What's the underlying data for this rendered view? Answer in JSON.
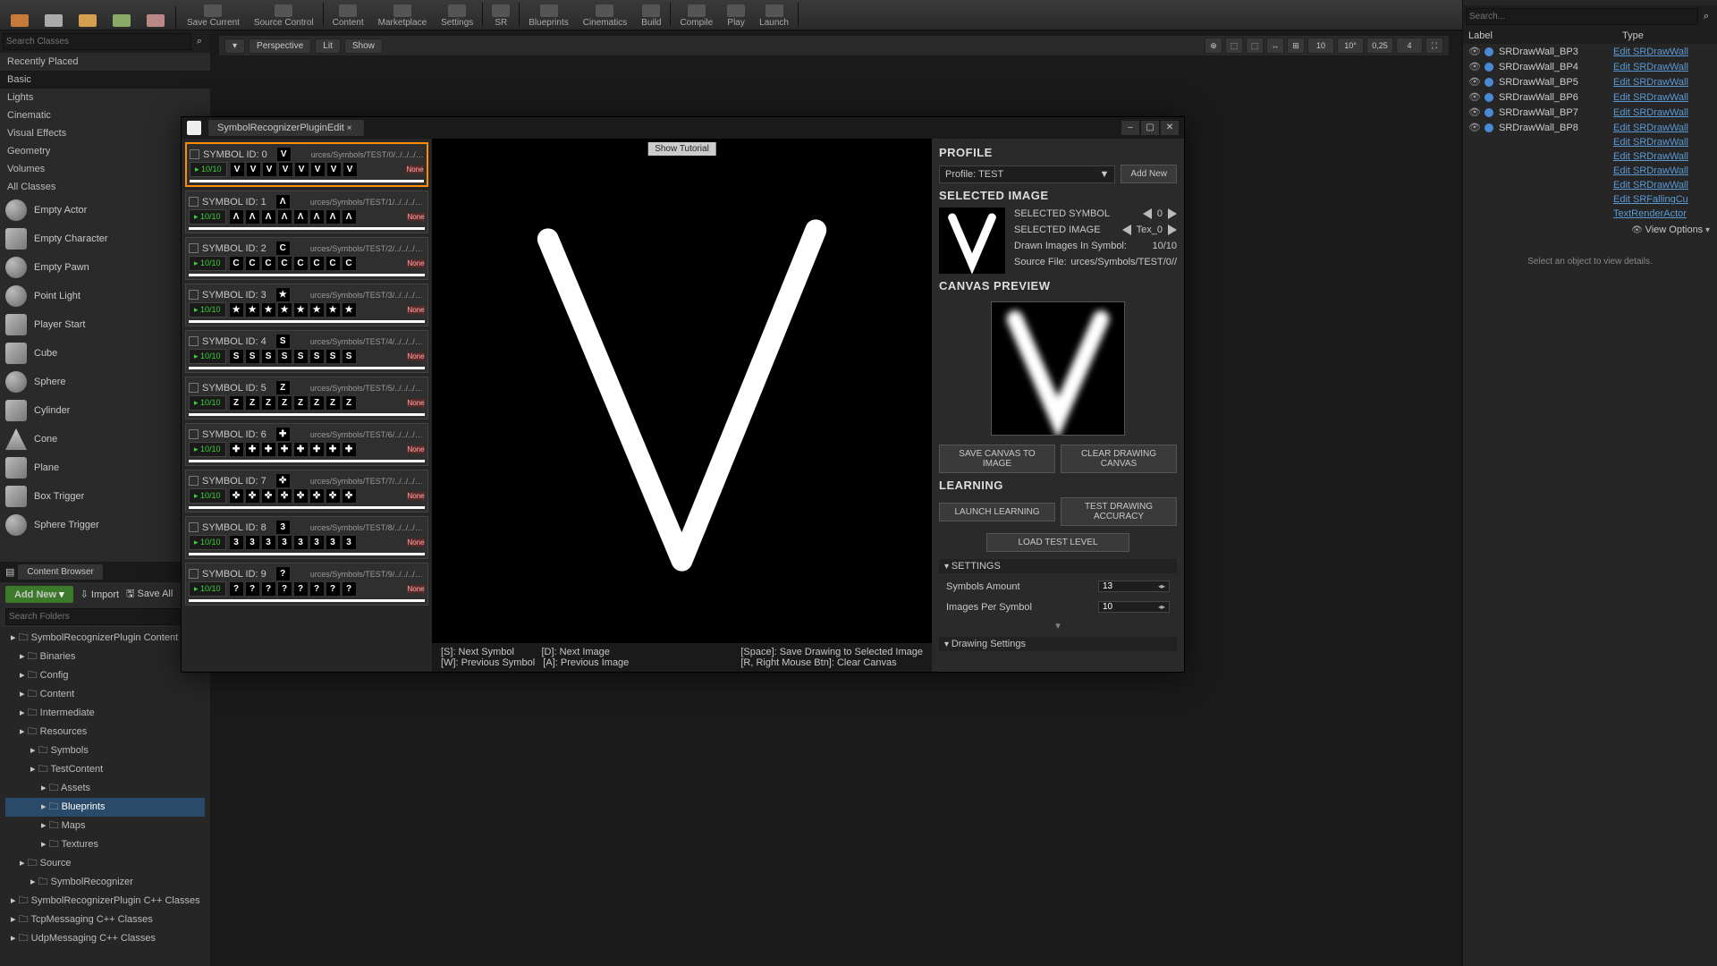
{
  "toolbar": {
    "items": [
      "Save Current",
      "Source Control",
      "Content",
      "Marketplace",
      "Settings",
      "SR",
      "Blueprints",
      "Cinematics",
      "Build",
      "Compile",
      "Play",
      "Launch"
    ]
  },
  "viewportBar": {
    "perspective": "Perspective",
    "lit": "Lit",
    "show": "Show",
    "right": [
      "10",
      "10°",
      "0,25",
      "4"
    ]
  },
  "modes": {
    "searchPlaceholder": "Search Classes",
    "categories": [
      "Recently Placed",
      "Basic",
      "Lights",
      "Cinematic",
      "Visual Effects",
      "Geometry",
      "Volumes",
      "All Classes"
    ],
    "activeCat": "Basic",
    "actors": [
      {
        "label": "Empty Actor",
        "shape": "sphere"
      },
      {
        "label": "Empty Character",
        "shape": "box"
      },
      {
        "label": "Empty Pawn",
        "shape": "sphere"
      },
      {
        "label": "Point Light",
        "shape": "sphere"
      },
      {
        "label": "Player Start",
        "shape": "box"
      },
      {
        "label": "Cube",
        "shape": "box"
      },
      {
        "label": "Sphere",
        "shape": "sphere"
      },
      {
        "label": "Cylinder",
        "shape": "box"
      },
      {
        "label": "Cone",
        "shape": "cone"
      },
      {
        "label": "Plane",
        "shape": "box"
      },
      {
        "label": "Box Trigger",
        "shape": "box"
      },
      {
        "label": "Sphere Trigger",
        "shape": "sphere"
      }
    ]
  },
  "contentBrowser": {
    "title": "Content Browser",
    "addNew": "Add New",
    "import": "Import",
    "saveAll": "Save All",
    "searchPlaceholder": "Search Folders",
    "tree": [
      {
        "l": "SymbolRecognizerPlugin Content",
        "d": 0
      },
      {
        "l": "Binaries",
        "d": 1
      },
      {
        "l": "Config",
        "d": 1
      },
      {
        "l": "Content",
        "d": 1
      },
      {
        "l": "Intermediate",
        "d": 1
      },
      {
        "l": "Resources",
        "d": 1
      },
      {
        "l": "Symbols",
        "d": 2
      },
      {
        "l": "TestContent",
        "d": 2
      },
      {
        "l": "Assets",
        "d": 3
      },
      {
        "l": "Blueprints",
        "d": 3,
        "sel": true
      },
      {
        "l": "Maps",
        "d": 3
      },
      {
        "l": "Textures",
        "d": 3
      },
      {
        "l": "Source",
        "d": 1
      },
      {
        "l": "SymbolRecognizer",
        "d": 2
      },
      {
        "l": "SymbolRecognizerPlugin C++ Classes",
        "d": 0
      },
      {
        "l": "TcpMessaging C++ Classes",
        "d": 0
      },
      {
        "l": "UdpMessaging C++ Classes",
        "d": 0
      }
    ]
  },
  "outliner": {
    "searchPlaceholder": "Search...",
    "labelHdr": "Label",
    "typeHdr": "Type",
    "rows": [
      {
        "name": "SRDrawWall_BP3",
        "type": "Edit SRDrawWall"
      },
      {
        "name": "SRDrawWall_BP4",
        "type": "Edit SRDrawWall"
      },
      {
        "name": "SRDrawWall_BP5",
        "type": "Edit SRDrawWall"
      },
      {
        "name": "SRDrawWall_BP6",
        "type": "Edit SRDrawWall"
      },
      {
        "name": "SRDrawWall_BP7",
        "type": "Edit SRDrawWall"
      },
      {
        "name": "SRDrawWall_BP8",
        "type": "Edit SRDrawWall"
      }
    ],
    "extraTypes": [
      "Edit SRDrawWall",
      "Edit SRDrawWall",
      "Edit SRDrawWall",
      "Edit SRDrawWall",
      "Edit SRFallingCu",
      "TextRenderActor"
    ],
    "viewOptions": "View Options",
    "detailsHint": "Select an object to view details."
  },
  "pluginWindow": {
    "tab": "SymbolRecognizerPluginEdit",
    "showTutorial": "Show Tutorial",
    "symbols": [
      {
        "id": 0,
        "path": "urces/Symbols/TEST/0/../../../../../..",
        "glyph": "V",
        "count": "10/10",
        "sel": true
      },
      {
        "id": 1,
        "path": "urces/Symbols/TEST/1/../../../../../..",
        "glyph": "Λ",
        "count": "10/10"
      },
      {
        "id": 2,
        "path": "urces/Symbols/TEST/2/../../../../../..",
        "glyph": "C",
        "count": "10/10"
      },
      {
        "id": 3,
        "path": "urces/Symbols/TEST/3/../../../../../..",
        "glyph": "★",
        "count": "10/10"
      },
      {
        "id": 4,
        "path": "urces/Symbols/TEST/4/../../../../../..",
        "glyph": "S",
        "count": "10/10"
      },
      {
        "id": 5,
        "path": "urces/Symbols/TEST/5/../../../../../..",
        "glyph": "Z",
        "count": "10/10"
      },
      {
        "id": 6,
        "path": "urces/Symbols/TEST/6/../../../../../..",
        "glyph": "✚",
        "count": "10/10"
      },
      {
        "id": 7,
        "path": "urces/Symbols/TEST/7/../../../../../..",
        "glyph": "✜",
        "count": "10/10"
      },
      {
        "id": 8,
        "path": "urces/Symbols/TEST/8/../../../../../..",
        "glyph": "3",
        "count": "10/10"
      },
      {
        "id": 9,
        "path": "urces/Symbols/TEST/9/../../../../../..",
        "glyph": "?",
        "count": "10/10"
      }
    ],
    "symbolIdPrefix": "SYMBOL ID: ",
    "noneLabel": "None",
    "hints": {
      "left": "[S]: Next Symbol          [D]: Next Image\n[W]: Previous Symbol   [A]: Previous Image",
      "right": "[Space]: Save Drawing to Selected Image\n[R, Right Mouse Btn]: Clear Canvas"
    },
    "inspector": {
      "profileHdr": "PROFILE",
      "profileValue": "Profile: TEST",
      "addNew": "Add New",
      "selImgHdr": "SELECTED IMAGE",
      "selSymbolLbl": "SELECTED SYMBOL",
      "selSymbolVal": "0",
      "selImageLbl": "SELECTED IMAGE",
      "selImageVal": "Tex_0",
      "drawnLbl": "Drawn Images In Symbol:",
      "drawnVal": "10/10",
      "srcFileLbl": "Source File:",
      "srcFileVal": "urces/Symbols/TEST/0//",
      "canvasPrevHdr": "CANVAS PREVIEW",
      "saveCanvas": "SAVE CANVAS TO IMAGE",
      "clearCanvas": "CLEAR DRAWING CANVAS",
      "learningHdr": "LEARNING",
      "launchLearning": "LAUNCH LEARNING",
      "testAccuracy": "TEST DRAWING ACCURACY",
      "loadTestLevel": "LOAD TEST LEVEL",
      "settingsHdr": "SETTINGS",
      "symbolsAmountLbl": "Symbols Amount",
      "symbolsAmountVal": "13",
      "imagesPerSymbolLbl": "Images Per Symbol",
      "imagesPerSymbolVal": "10",
      "drawingSettings": "Drawing Settings"
    }
  }
}
